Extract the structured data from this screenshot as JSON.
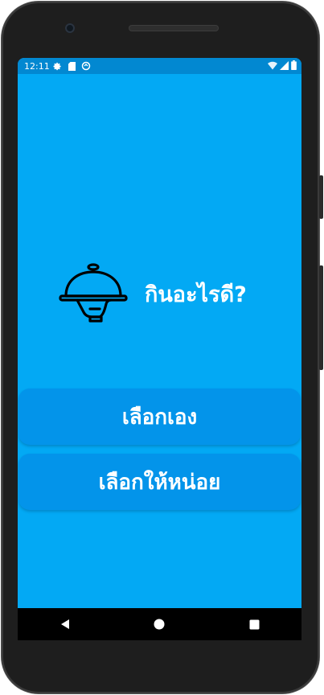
{
  "status_bar": {
    "time": "12:11",
    "left_icons": [
      "settings-icon",
      "sd-card-icon",
      "sync-icon"
    ],
    "right_icons": [
      "wifi-icon",
      "signal-icon",
      "battery-icon"
    ]
  },
  "header": {
    "title": "กินอะไรดี?",
    "logo_icon": "food-cloche-icon"
  },
  "buttons": {
    "choose_self": "เลือกเอง",
    "choose_for_me": "เลือกให้หน่อย"
  },
  "nav_bar": {
    "icons": [
      "back-icon",
      "home-icon",
      "recents-icon"
    ]
  },
  "colors": {
    "background": "#03a9f4",
    "status_bar": "#0288d1",
    "button": "#0394ea",
    "text": "#ffffff"
  }
}
